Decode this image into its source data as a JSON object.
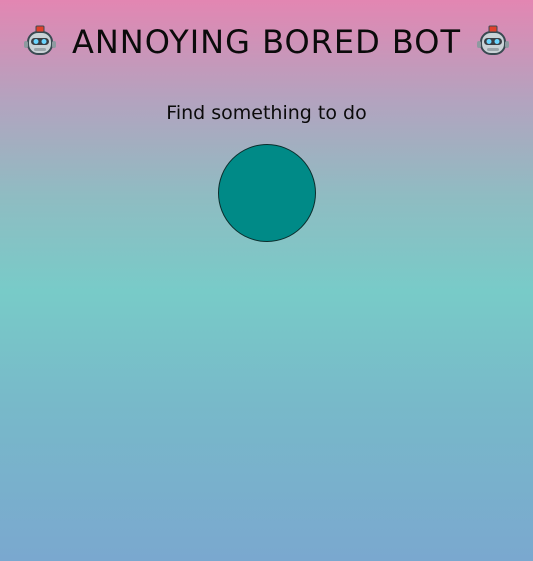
{
  "header": {
    "title": "ANNOYING BORED BOT",
    "left_icon": "robot-icon",
    "right_icon": "robot-icon"
  },
  "main": {
    "subtitle": "Find something to do"
  },
  "colors": {
    "gradient_top": "#e386b2",
    "gradient_middle": "#78cbc8",
    "gradient_bottom": "#7aa8cf",
    "button_fill": "#008a87",
    "button_border": "#0a2d2c",
    "text": "#0b0b0b"
  }
}
